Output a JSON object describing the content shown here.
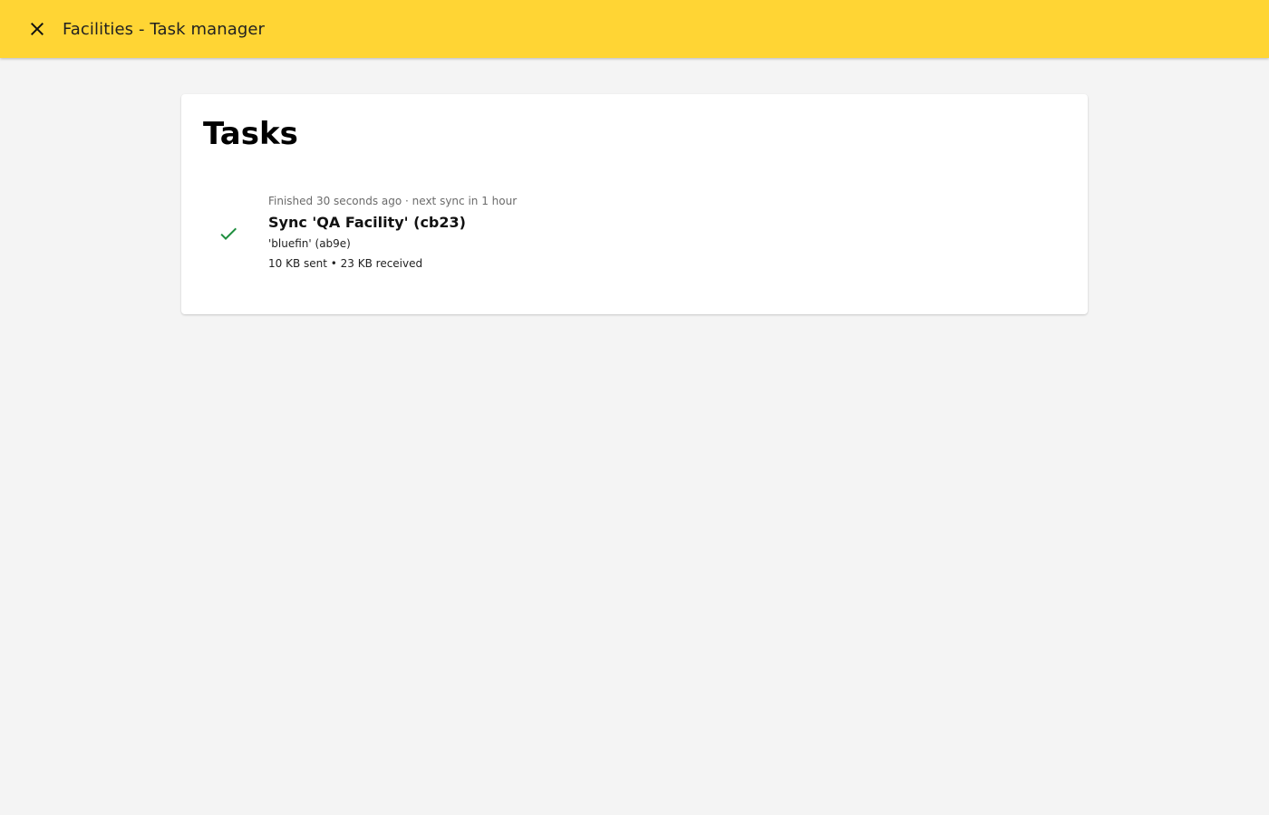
{
  "app": {
    "title": "Facilities - Task manager",
    "accent_color": "#ffd534",
    "close_icon": "close-icon"
  },
  "main": {
    "heading": "Tasks",
    "tasks": [
      {
        "status": "Finished 30 seconds ago · next sync in 1 hour",
        "title": "Sync 'QA Facility' (cb23)",
        "subtitle": "'bluefin' (ab9e)",
        "stats": "10 KB sent • 23 KB received",
        "icon": "check-icon",
        "icon_color": "#1e8e3e"
      }
    ]
  }
}
